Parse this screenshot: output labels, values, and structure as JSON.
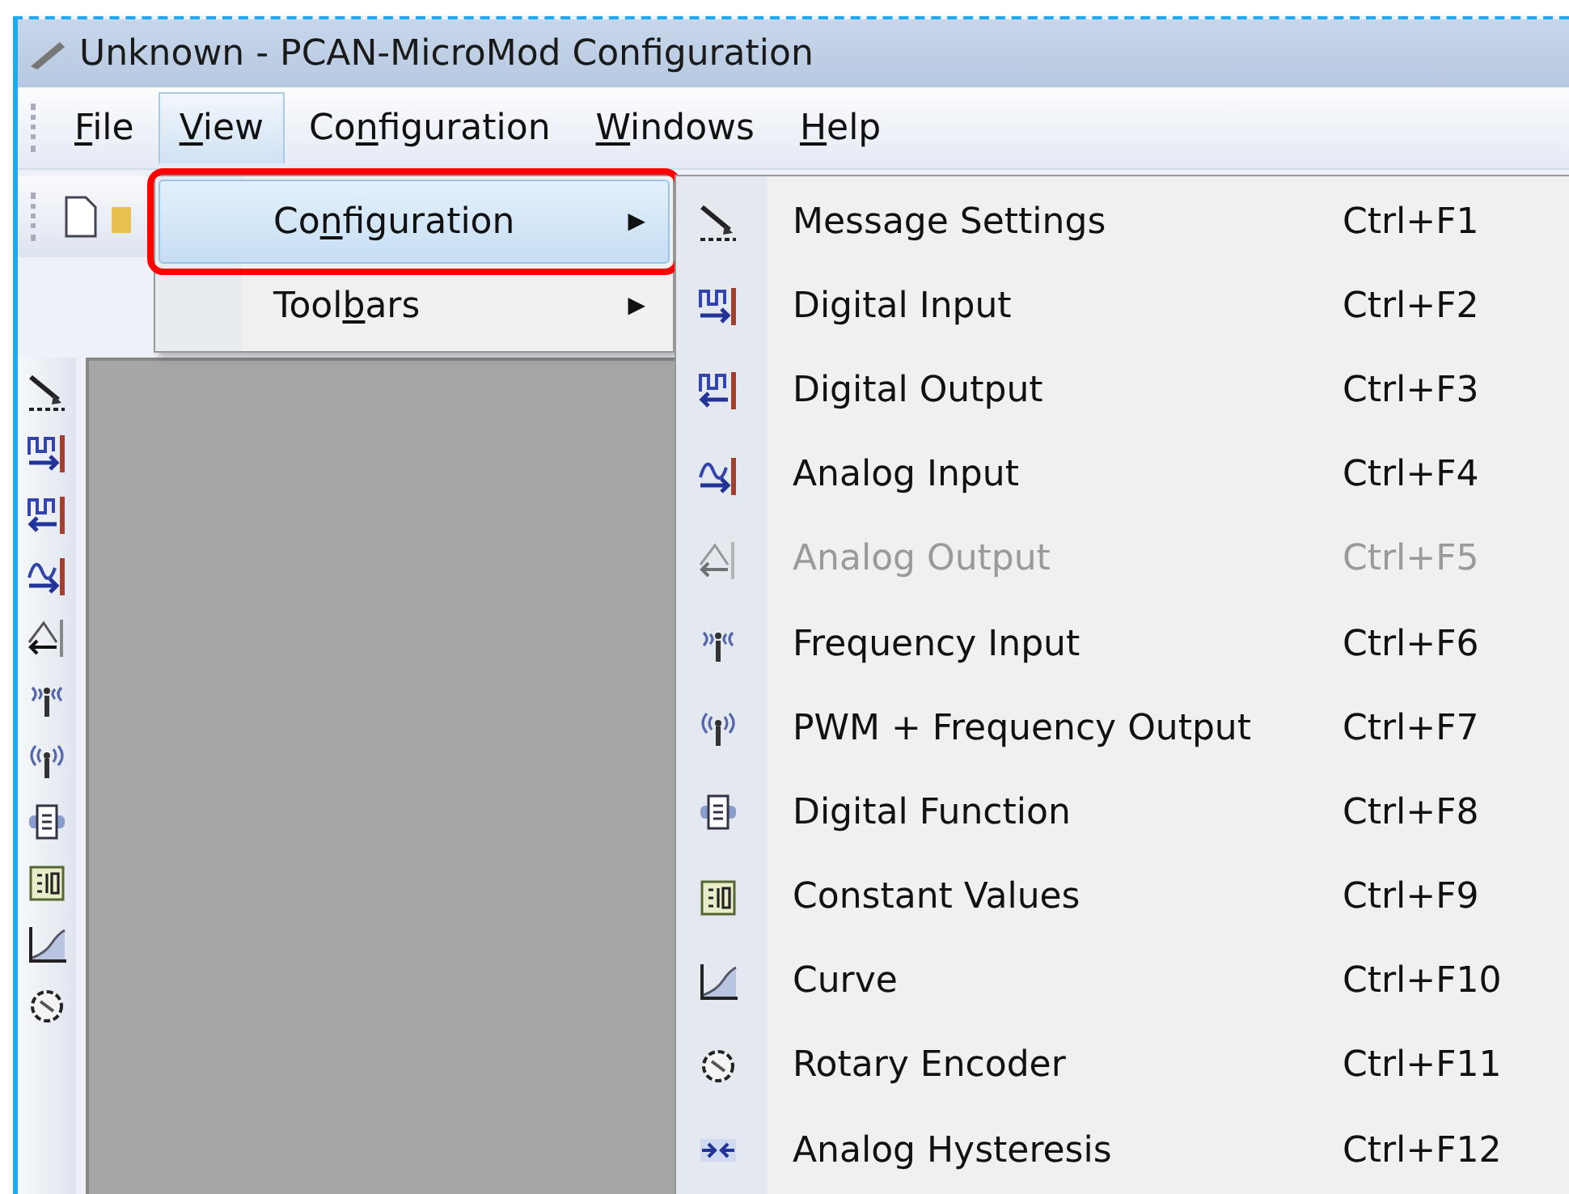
{
  "window": {
    "title": "Unknown - PCAN-MicroMod Configuration"
  },
  "menu_bar": [
    {
      "key": "F",
      "after": "ile",
      "selected": false
    },
    {
      "key": "V",
      "after": "iew",
      "selected": true
    },
    {
      "before": "Co",
      "key": "n",
      "after": "figuration",
      "selected": false
    },
    {
      "key": "W",
      "after": "indows",
      "selected": false
    },
    {
      "key": "H",
      "after": "elp",
      "selected": false
    }
  ],
  "view_menu": [
    {
      "before": "Co",
      "key": "n",
      "after": "figuration",
      "arrow": "▶",
      "selected": true,
      "highlighted_by_annotation": true
    },
    {
      "before": "Tool",
      "key": "b",
      "after": "ars",
      "arrow": "▶",
      "selected": false,
      "highlighted_by_annotation": false
    }
  ],
  "configuration_submenu": [
    {
      "label": "Message Settings",
      "shortcut": "Ctrl+F1",
      "disabled": false
    },
    {
      "label": "Digital Input",
      "shortcut": "Ctrl+F2",
      "disabled": false
    },
    {
      "label": "Digital Output",
      "shortcut": "Ctrl+F3",
      "disabled": false
    },
    {
      "label": "Analog Input",
      "shortcut": "Ctrl+F4",
      "disabled": false
    },
    {
      "label": "Analog Output",
      "shortcut": "Ctrl+F5",
      "disabled": true
    },
    {
      "label": "Frequency Input",
      "shortcut": "Ctrl+F6",
      "disabled": false
    },
    {
      "label": "PWM + Frequency Output",
      "shortcut": "Ctrl+F7",
      "disabled": false
    },
    {
      "label": "Digital Function",
      "shortcut": "Ctrl+F8",
      "disabled": false
    },
    {
      "label": "Constant Values",
      "shortcut": "Ctrl+F9",
      "disabled": false
    },
    {
      "label": "Curve",
      "shortcut": "Ctrl+F10",
      "disabled": false
    },
    {
      "label": "Rotary Encoder",
      "shortcut": "Ctrl+F11",
      "disabled": false
    },
    {
      "label": "Analog Hysteresis",
      "shortcut": "Ctrl+F12",
      "disabled": false
    }
  ]
}
